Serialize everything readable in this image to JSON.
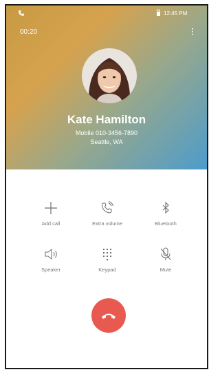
{
  "status": {
    "time": "12:45 PM"
  },
  "call": {
    "timer": "00:20"
  },
  "contact": {
    "name": "Kate Hamilton",
    "number": "Mobile 010-3456-7890",
    "location": "Seattle, WA"
  },
  "actions": {
    "add_call": "Add call",
    "extra_volume": "Extra volume",
    "bluetooth": "Bluetooth",
    "speaker": "Speaker",
    "keypad": "Keypad",
    "mute": "Mute"
  },
  "colors": {
    "end_call": "#e85a50",
    "header_gradient": [
      "#c79a42",
      "#4d9ccc"
    ]
  }
}
